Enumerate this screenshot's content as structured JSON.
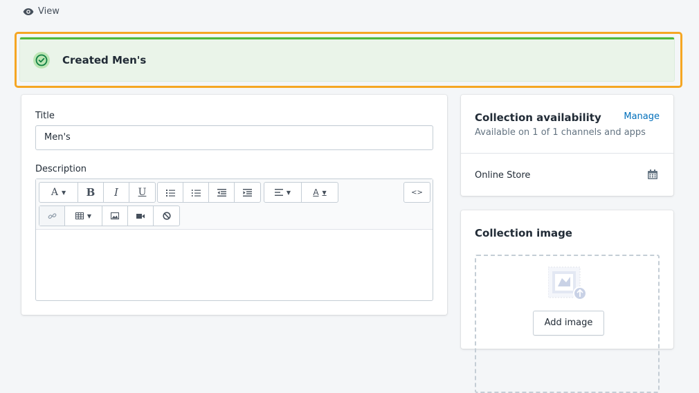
{
  "header": {
    "view_label": "View"
  },
  "banner": {
    "message": "Created Men's",
    "accent_color": "#50b83c",
    "highlight_color": "#f5a623"
  },
  "form": {
    "title_label": "Title",
    "title_value": "Men's",
    "description_label": "Description",
    "toolbar": {
      "font_button": "A",
      "bold_button": "B",
      "italic_button": "I",
      "underline_button": "U",
      "html_button": "<>",
      "text_color_button": "A"
    }
  },
  "availability": {
    "title": "Collection availability",
    "manage_label": "Manage",
    "summary": "Available on 1 of 1 channels and apps",
    "channel": "Online Store"
  },
  "collection_image": {
    "title": "Collection image",
    "add_button": "Add image"
  },
  "icons": {
    "view": "eye-icon",
    "banner": "check-circle-icon",
    "calendar": "calendar-icon"
  }
}
